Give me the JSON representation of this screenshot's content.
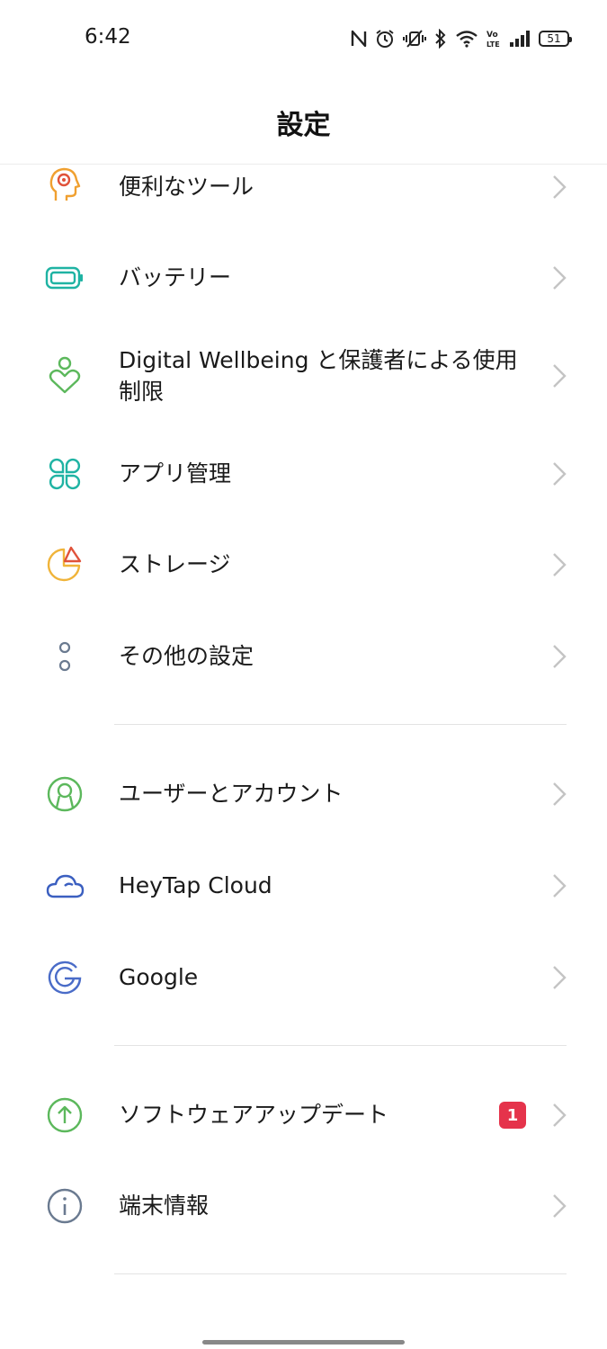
{
  "status_bar": {
    "time": "6:42",
    "battery_level": "51",
    "icons": [
      "nfc-icon",
      "alarm-icon",
      "vibrate-icon",
      "bluetooth-icon",
      "wifi-icon",
      "volte-icon",
      "signal-icon",
      "battery-icon"
    ]
  },
  "header": {
    "title": "設定"
  },
  "items": [
    {
      "label": "便利なツール",
      "icon": "smart-tools-icon"
    },
    {
      "label": "バッテリー",
      "icon": "battery-icon"
    },
    {
      "label": "Digital Wellbeing と保護者による使用制限",
      "icon": "wellbeing-icon"
    },
    {
      "label": "アプリ管理",
      "icon": "app-management-icon"
    },
    {
      "label": "ストレージ",
      "icon": "storage-icon"
    },
    {
      "label": "その他の設定",
      "icon": "more-settings-icon"
    },
    {
      "label": "ユーザーとアカウント",
      "icon": "user-account-icon"
    },
    {
      "label": "HeyTap Cloud",
      "icon": "cloud-icon"
    },
    {
      "label": "Google",
      "icon": "google-icon"
    },
    {
      "label": "ソフトウェアアップデート",
      "icon": "software-update-icon",
      "badge": "1"
    },
    {
      "label": "端末情報",
      "icon": "info-icon"
    }
  ],
  "colors": {
    "badge": "#e5334b",
    "teal": "#1fb3a3",
    "green": "#5cb85c",
    "blue": "#3b5fc0",
    "orange": "#f0a030"
  }
}
